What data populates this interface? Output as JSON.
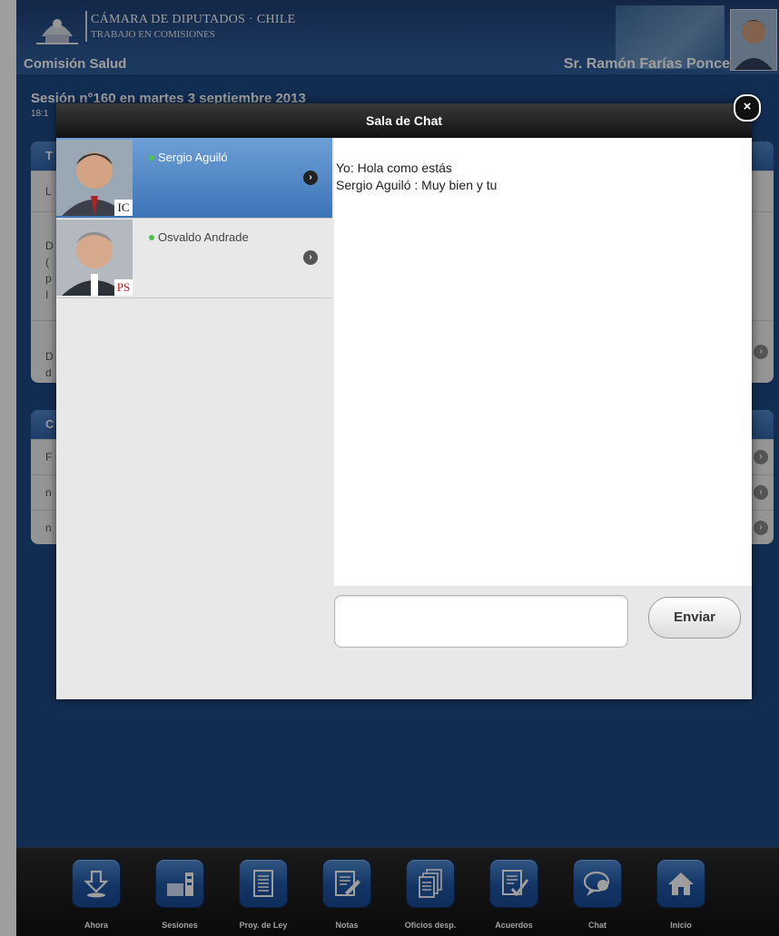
{
  "header": {
    "brand_line1": "CÁMARA DE DIPUTADOS · CHILE",
    "brand_line2": "TRABAJO EN COMISIONES",
    "commission": "Comisión Salud",
    "user_name": "Sr. Ramón Farías Ponce"
  },
  "page": {
    "session_title": "Sesión n°160 en martes 3 septiembre 2013",
    "session_time": "18:1",
    "card1": {
      "head": "T",
      "rows": [
        "L",
        "D\n(\np\nI",
        "D\nd"
      ]
    },
    "card2": {
      "head": "C",
      "rows": [
        "F",
        "n",
        "n"
      ]
    }
  },
  "chat": {
    "title": "Sala de Chat",
    "close_label": "×",
    "contacts": [
      {
        "name": "Sergio Aguiló",
        "party_tag": "IC",
        "active": true
      },
      {
        "name": "Osvaldo Andrade",
        "party_tag": "PS",
        "active": false
      }
    ],
    "messages": [
      "Yo: Hola como estás",
      "Sergio Aguiló : Muy bien y tu"
    ],
    "input_value": "",
    "send_label": "Enviar"
  },
  "toolbar": {
    "items": [
      {
        "label": "Ahora",
        "icon": "download-icon"
      },
      {
        "label": "Sesiones",
        "icon": "sessions-icon"
      },
      {
        "label": "Proy. de Ley",
        "icon": "document-icon"
      },
      {
        "label": "Notas",
        "icon": "notes-icon"
      },
      {
        "label": "Oficios desp.",
        "icon": "stacked-docs-icon"
      },
      {
        "label": "Acuerdos",
        "icon": "agreement-icon"
      },
      {
        "label": "Chat",
        "icon": "chat-bubble-icon"
      },
      {
        "label": "Inicio",
        "icon": "home-icon"
      }
    ]
  },
  "colors": {
    "header_blue": "#1e3f74",
    "accent_blue": "#3d74b8",
    "online_green": "#4cc24a"
  }
}
